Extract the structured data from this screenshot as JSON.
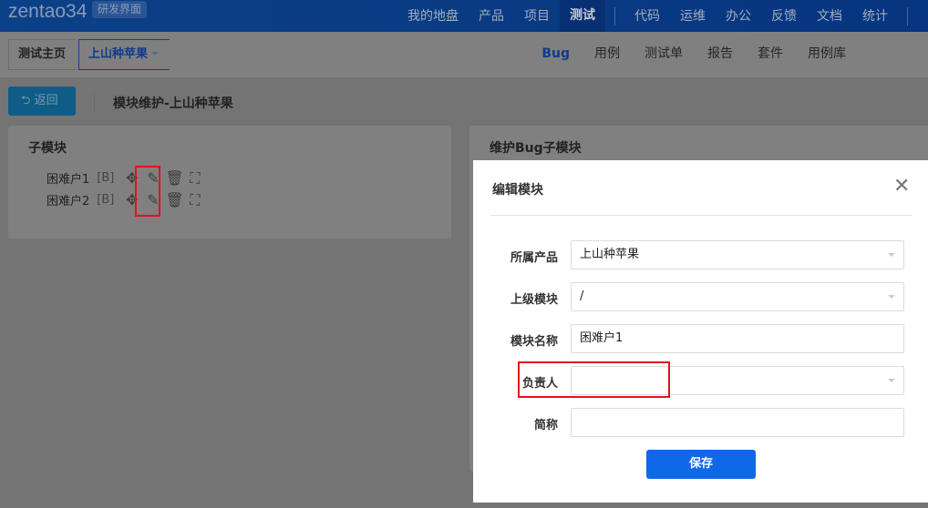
{
  "header": {
    "logo": "zentao34",
    "badge": "研发界面",
    "nav": [
      "我的地盘",
      "产品",
      "项目",
      "测试"
    ],
    "nav2": [
      "代码",
      "运维",
      "办公",
      "反馈",
      "文档",
      "统计"
    ],
    "active": "测试"
  },
  "breadcrumb": {
    "home": "测试主页",
    "product": "上山种苹果"
  },
  "subnav": [
    "Bug",
    "用例",
    "测试单",
    "报告",
    "套件",
    "用例库"
  ],
  "toolbar": {
    "back": "返回",
    "title": "模块维护-上山种苹果"
  },
  "left_panel": {
    "title": "子模块",
    "items": [
      {
        "name": "困难户1",
        "tag": "[B]"
      },
      {
        "name": "困难户2",
        "tag": "[B]"
      }
    ]
  },
  "right_panel": {
    "title": "维护Bug子模块"
  },
  "modal": {
    "title": "编辑模块",
    "fields": [
      {
        "label": "所属产品",
        "value": "上山种苹果",
        "type": "select"
      },
      {
        "label": "上级模块",
        "value": "/",
        "type": "select"
      },
      {
        "label": "模块名称",
        "value": "困难户1",
        "type": "text"
      },
      {
        "label": "负责人",
        "value": "",
        "type": "select"
      },
      {
        "label": "简称",
        "value": "",
        "type": "text"
      }
    ],
    "save": "保存"
  },
  "colors": {
    "accent": "#0e68e8",
    "highlight": "#e0141c"
  }
}
